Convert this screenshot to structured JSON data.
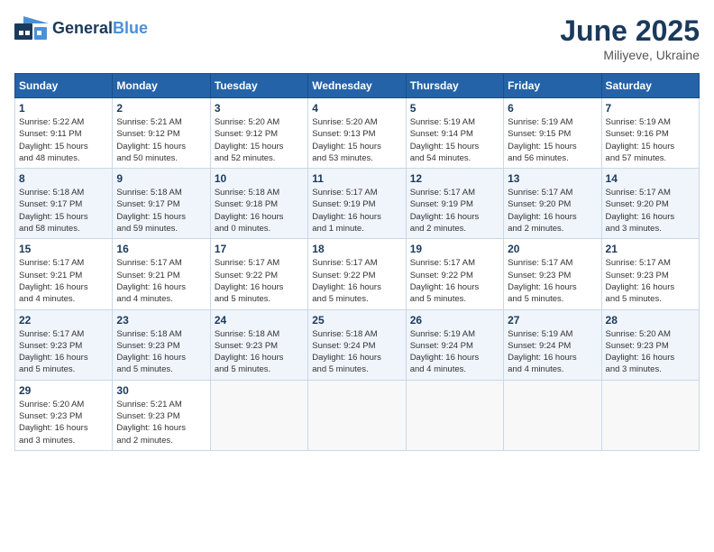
{
  "header": {
    "logo_general": "General",
    "logo_blue": "Blue",
    "title": "June 2025",
    "location": "Miliyeve, Ukraine"
  },
  "days_of_week": [
    "Sunday",
    "Monday",
    "Tuesday",
    "Wednesday",
    "Thursday",
    "Friday",
    "Saturday"
  ],
  "weeks": [
    [
      {
        "day": "1",
        "info": "Sunrise: 5:22 AM\nSunset: 9:11 PM\nDaylight: 15 hours\nand 48 minutes."
      },
      {
        "day": "2",
        "info": "Sunrise: 5:21 AM\nSunset: 9:12 PM\nDaylight: 15 hours\nand 50 minutes."
      },
      {
        "day": "3",
        "info": "Sunrise: 5:20 AM\nSunset: 9:12 PM\nDaylight: 15 hours\nand 52 minutes."
      },
      {
        "day": "4",
        "info": "Sunrise: 5:20 AM\nSunset: 9:13 PM\nDaylight: 15 hours\nand 53 minutes."
      },
      {
        "day": "5",
        "info": "Sunrise: 5:19 AM\nSunset: 9:14 PM\nDaylight: 15 hours\nand 54 minutes."
      },
      {
        "day": "6",
        "info": "Sunrise: 5:19 AM\nSunset: 9:15 PM\nDaylight: 15 hours\nand 56 minutes."
      },
      {
        "day": "7",
        "info": "Sunrise: 5:19 AM\nSunset: 9:16 PM\nDaylight: 15 hours\nand 57 minutes."
      }
    ],
    [
      {
        "day": "8",
        "info": "Sunrise: 5:18 AM\nSunset: 9:17 PM\nDaylight: 15 hours\nand 58 minutes."
      },
      {
        "day": "9",
        "info": "Sunrise: 5:18 AM\nSunset: 9:17 PM\nDaylight: 15 hours\nand 59 minutes."
      },
      {
        "day": "10",
        "info": "Sunrise: 5:18 AM\nSunset: 9:18 PM\nDaylight: 16 hours\nand 0 minutes."
      },
      {
        "day": "11",
        "info": "Sunrise: 5:17 AM\nSunset: 9:19 PM\nDaylight: 16 hours\nand 1 minute."
      },
      {
        "day": "12",
        "info": "Sunrise: 5:17 AM\nSunset: 9:19 PM\nDaylight: 16 hours\nand 2 minutes."
      },
      {
        "day": "13",
        "info": "Sunrise: 5:17 AM\nSunset: 9:20 PM\nDaylight: 16 hours\nand 2 minutes."
      },
      {
        "day": "14",
        "info": "Sunrise: 5:17 AM\nSunset: 9:20 PM\nDaylight: 16 hours\nand 3 minutes."
      }
    ],
    [
      {
        "day": "15",
        "info": "Sunrise: 5:17 AM\nSunset: 9:21 PM\nDaylight: 16 hours\nand 4 minutes."
      },
      {
        "day": "16",
        "info": "Sunrise: 5:17 AM\nSunset: 9:21 PM\nDaylight: 16 hours\nand 4 minutes."
      },
      {
        "day": "17",
        "info": "Sunrise: 5:17 AM\nSunset: 9:22 PM\nDaylight: 16 hours\nand 5 minutes."
      },
      {
        "day": "18",
        "info": "Sunrise: 5:17 AM\nSunset: 9:22 PM\nDaylight: 16 hours\nand 5 minutes."
      },
      {
        "day": "19",
        "info": "Sunrise: 5:17 AM\nSunset: 9:22 PM\nDaylight: 16 hours\nand 5 minutes."
      },
      {
        "day": "20",
        "info": "Sunrise: 5:17 AM\nSunset: 9:23 PM\nDaylight: 16 hours\nand 5 minutes."
      },
      {
        "day": "21",
        "info": "Sunrise: 5:17 AM\nSunset: 9:23 PM\nDaylight: 16 hours\nand 5 minutes."
      }
    ],
    [
      {
        "day": "22",
        "info": "Sunrise: 5:17 AM\nSunset: 9:23 PM\nDaylight: 16 hours\nand 5 minutes."
      },
      {
        "day": "23",
        "info": "Sunrise: 5:18 AM\nSunset: 9:23 PM\nDaylight: 16 hours\nand 5 minutes."
      },
      {
        "day": "24",
        "info": "Sunrise: 5:18 AM\nSunset: 9:23 PM\nDaylight: 16 hours\nand 5 minutes."
      },
      {
        "day": "25",
        "info": "Sunrise: 5:18 AM\nSunset: 9:24 PM\nDaylight: 16 hours\nand 5 minutes."
      },
      {
        "day": "26",
        "info": "Sunrise: 5:19 AM\nSunset: 9:24 PM\nDaylight: 16 hours\nand 4 minutes."
      },
      {
        "day": "27",
        "info": "Sunrise: 5:19 AM\nSunset: 9:24 PM\nDaylight: 16 hours\nand 4 minutes."
      },
      {
        "day": "28",
        "info": "Sunrise: 5:20 AM\nSunset: 9:23 PM\nDaylight: 16 hours\nand 3 minutes."
      }
    ],
    [
      {
        "day": "29",
        "info": "Sunrise: 5:20 AM\nSunset: 9:23 PM\nDaylight: 16 hours\nand 3 minutes."
      },
      {
        "day": "30",
        "info": "Sunrise: 5:21 AM\nSunset: 9:23 PM\nDaylight: 16 hours\nand 2 minutes."
      },
      {
        "day": "",
        "info": ""
      },
      {
        "day": "",
        "info": ""
      },
      {
        "day": "",
        "info": ""
      },
      {
        "day": "",
        "info": ""
      },
      {
        "day": "",
        "info": ""
      }
    ]
  ]
}
